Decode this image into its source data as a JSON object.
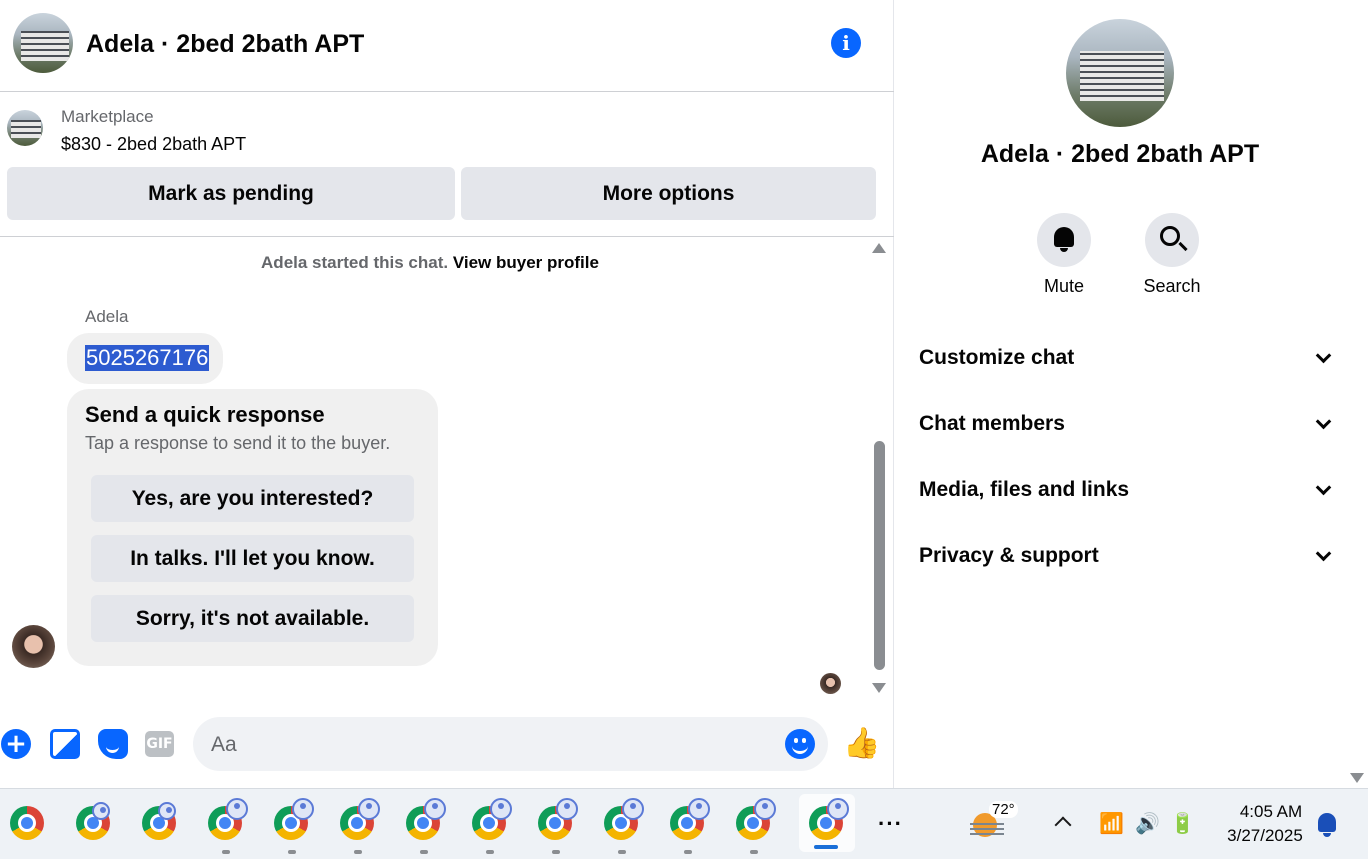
{
  "header": {
    "title": "Adela · 2bed 2bath APT",
    "info_icon": "info-icon"
  },
  "marketplace": {
    "label": "Marketplace",
    "price_title": "$830 - 2bed 2bath APT",
    "mark_pending": "Mark as pending",
    "more_options": "More options"
  },
  "conversation": {
    "started_text": "Adela started this chat.",
    "view_profile": "View buyer profile",
    "sender_name": "Adela",
    "message": "5025267176",
    "quick_response": {
      "title": "Send a quick response",
      "subtitle": "Tap a response to send it to the buyer.",
      "options": [
        "Yes, are you interested?",
        "In talks. I'll let you know.",
        "Sorry, it's not available."
      ]
    }
  },
  "composer": {
    "placeholder": "Aa",
    "gif_label": "GIF",
    "icons": [
      "plus-icon",
      "photo-icon",
      "sticker-icon",
      "gif-icon",
      "emoji-icon",
      "like-icon"
    ]
  },
  "info_panel": {
    "title": "Adela · 2bed 2bath APT",
    "actions": [
      {
        "label": "Mute",
        "icon": "bell-icon"
      },
      {
        "label": "Search",
        "icon": "search-icon"
      }
    ],
    "sections": [
      "Customize chat",
      "Chat members",
      "Media, files and links",
      "Privacy & support"
    ]
  },
  "taskbar": {
    "more": "···",
    "weather_temp": "72°",
    "time": "4:05 AM",
    "date": "3/27/2025"
  },
  "colors": {
    "accent": "#0866ff",
    "selection": "#2d5bd0",
    "button_grey": "#e4e6eb",
    "bubble": "#f0f0f0"
  }
}
